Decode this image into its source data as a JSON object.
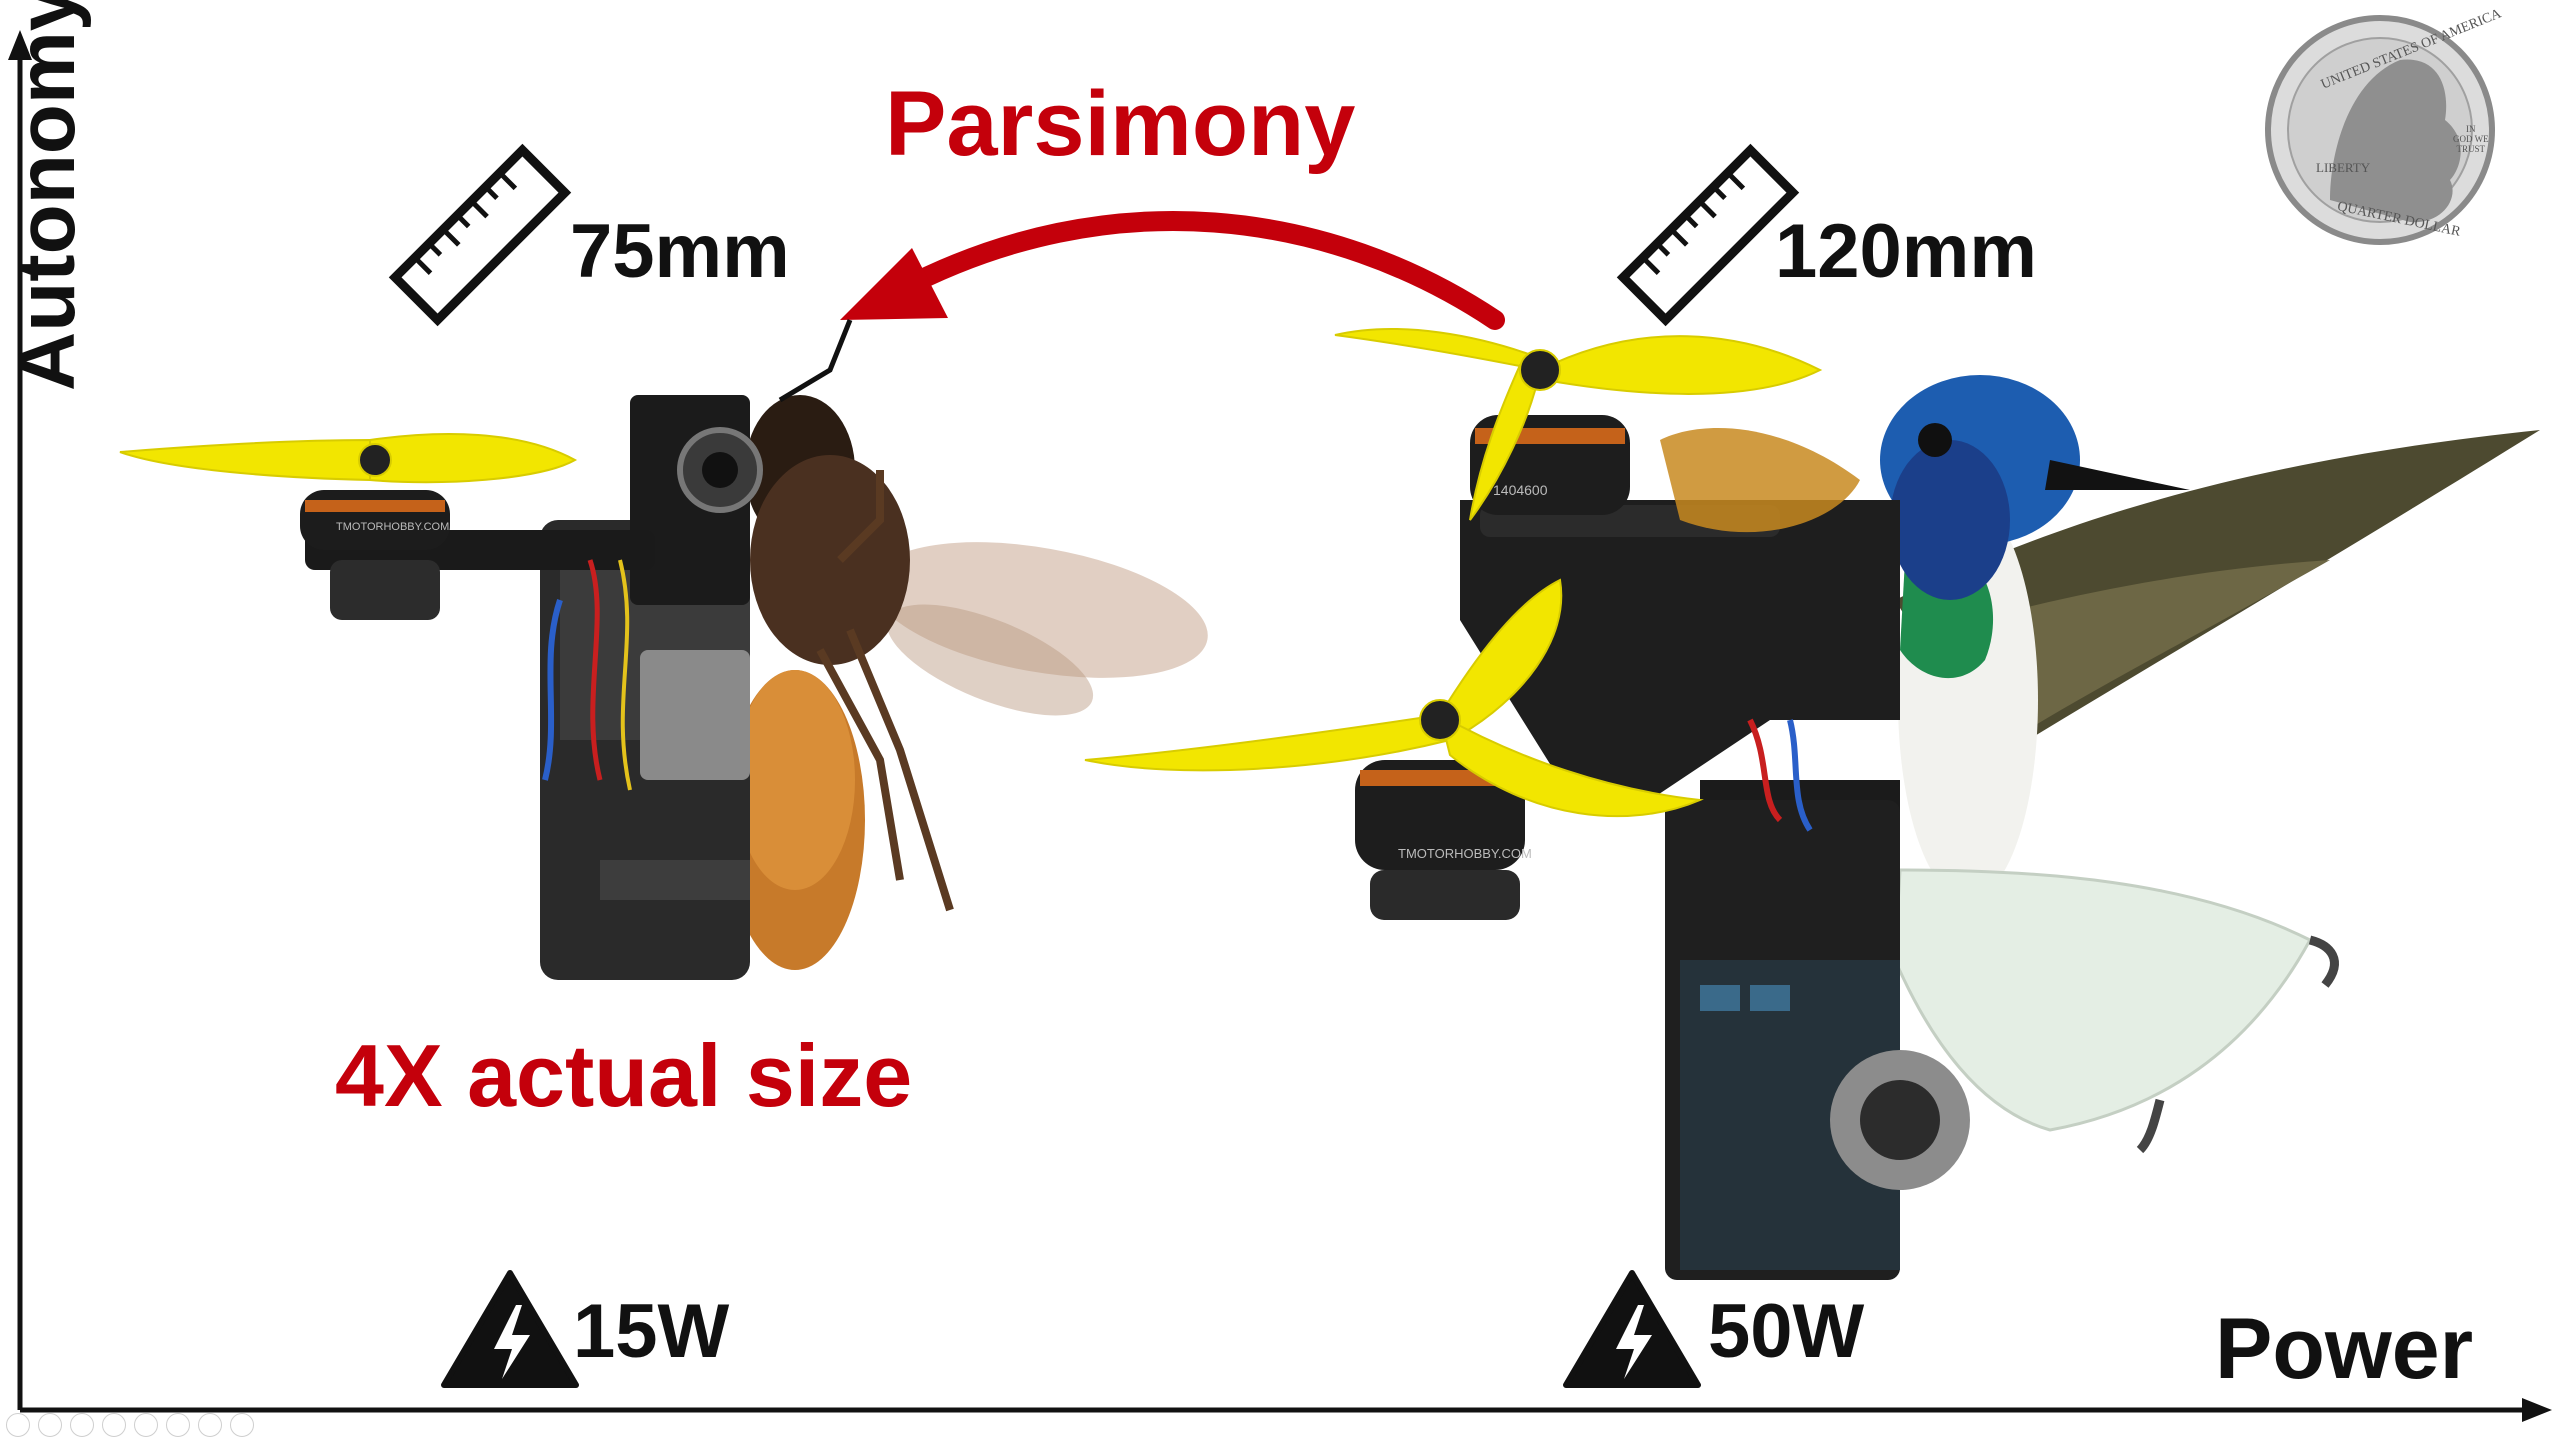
{
  "axes": {
    "y_label": "Autonomy",
    "x_label": "Power"
  },
  "title": "Parsimony",
  "caption": "4X actual size",
  "small_drone": {
    "size": "75mm",
    "power": "15W",
    "motor_brand": "TMOTORHOBBY.COM",
    "comparison": "bee"
  },
  "large_drone": {
    "size": "120mm",
    "power": "50W",
    "motor_brand": "TMOTORHOBBY.COM",
    "motor_model": "1404600",
    "comparison": "hummingbird"
  },
  "coin": {
    "top_text": "UNITED STATES OF AMERICA",
    "bottom_text": "QUARTER DOLLAR",
    "left_text": "LIBERTY",
    "motto_line1": "IN",
    "motto_line2": "GOD WE",
    "motto_line3": "TRUST"
  },
  "icons": [
    "ruler-icon",
    "power-warning-icon"
  ],
  "colors": {
    "accent_red": "#c4000b",
    "propeller_yellow": "#f2e600",
    "axis": "#111111"
  }
}
